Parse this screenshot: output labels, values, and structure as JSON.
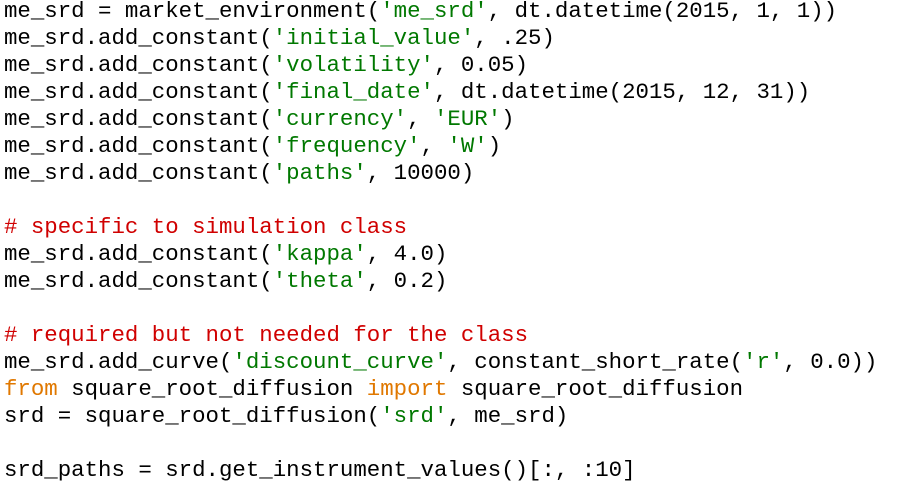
{
  "editor": {
    "lines": [
      [
        {
          "t": "txt",
          "v": "me_srd = market_environment("
        },
        {
          "t": "str",
          "v": "'me_srd'"
        },
        {
          "t": "txt",
          "v": ", dt.datetime(2015, 1, 1))"
        }
      ],
      [
        {
          "t": "txt",
          "v": "me_srd.add_constant("
        },
        {
          "t": "str",
          "v": "'initial_value'"
        },
        {
          "t": "txt",
          "v": ", .25)"
        }
      ],
      [
        {
          "t": "txt",
          "v": "me_srd.add_constant("
        },
        {
          "t": "str",
          "v": "'volatility'"
        },
        {
          "t": "txt",
          "v": ", 0.05)"
        }
      ],
      [
        {
          "t": "txt",
          "v": "me_srd.add_constant("
        },
        {
          "t": "str",
          "v": "'final_date'"
        },
        {
          "t": "txt",
          "v": ", dt.datetime(2015, 12, 31))"
        }
      ],
      [
        {
          "t": "txt",
          "v": "me_srd.add_constant("
        },
        {
          "t": "str",
          "v": "'currency'"
        },
        {
          "t": "txt",
          "v": ", "
        },
        {
          "t": "str",
          "v": "'EUR'"
        },
        {
          "t": "txt",
          "v": ")"
        }
      ],
      [
        {
          "t": "txt",
          "v": "me_srd.add_constant("
        },
        {
          "t": "str",
          "v": "'frequency'"
        },
        {
          "t": "txt",
          "v": ", "
        },
        {
          "t": "str",
          "v": "'W'"
        },
        {
          "t": "txt",
          "v": ")"
        }
      ],
      [
        {
          "t": "txt",
          "v": "me_srd.add_constant("
        },
        {
          "t": "str",
          "v": "'paths'"
        },
        {
          "t": "txt",
          "v": ", 10000)"
        }
      ],
      [],
      [
        {
          "t": "com",
          "v": "# specific to simulation class"
        }
      ],
      [
        {
          "t": "txt",
          "v": "me_srd.add_constant("
        },
        {
          "t": "str",
          "v": "'kappa'"
        },
        {
          "t": "txt",
          "v": ", 4.0)"
        }
      ],
      [
        {
          "t": "txt",
          "v": "me_srd.add_constant("
        },
        {
          "t": "str",
          "v": "'theta'"
        },
        {
          "t": "txt",
          "v": ", 0.2)"
        }
      ],
      [],
      [
        {
          "t": "com",
          "v": "# required but not needed for the class"
        }
      ],
      [
        {
          "t": "txt",
          "v": "me_srd.add_curve("
        },
        {
          "t": "str",
          "v": "'discount_curve'"
        },
        {
          "t": "txt",
          "v": ", constant_short_rate("
        },
        {
          "t": "str",
          "v": "'r'"
        },
        {
          "t": "txt",
          "v": ", 0.0))"
        }
      ],
      [
        {
          "t": "kw",
          "v": "from"
        },
        {
          "t": "txt",
          "v": " square_root_diffusion "
        },
        {
          "t": "kw",
          "v": "import"
        },
        {
          "t": "txt",
          "v": " square_root_diffusion"
        }
      ],
      [
        {
          "t": "txt",
          "v": "srd = square_root_diffusion("
        },
        {
          "t": "str",
          "v": "'srd'"
        },
        {
          "t": "txt",
          "v": ", me_srd)"
        }
      ],
      [],
      [
        {
          "t": "txt",
          "v": "srd_paths = srd.get_instrument_values()[:, :10]"
        }
      ]
    ]
  },
  "colors": {
    "text": "#000000",
    "string": "#007800",
    "comment": "#d00000",
    "keyword": "#e07800",
    "background": "#ffffff"
  }
}
